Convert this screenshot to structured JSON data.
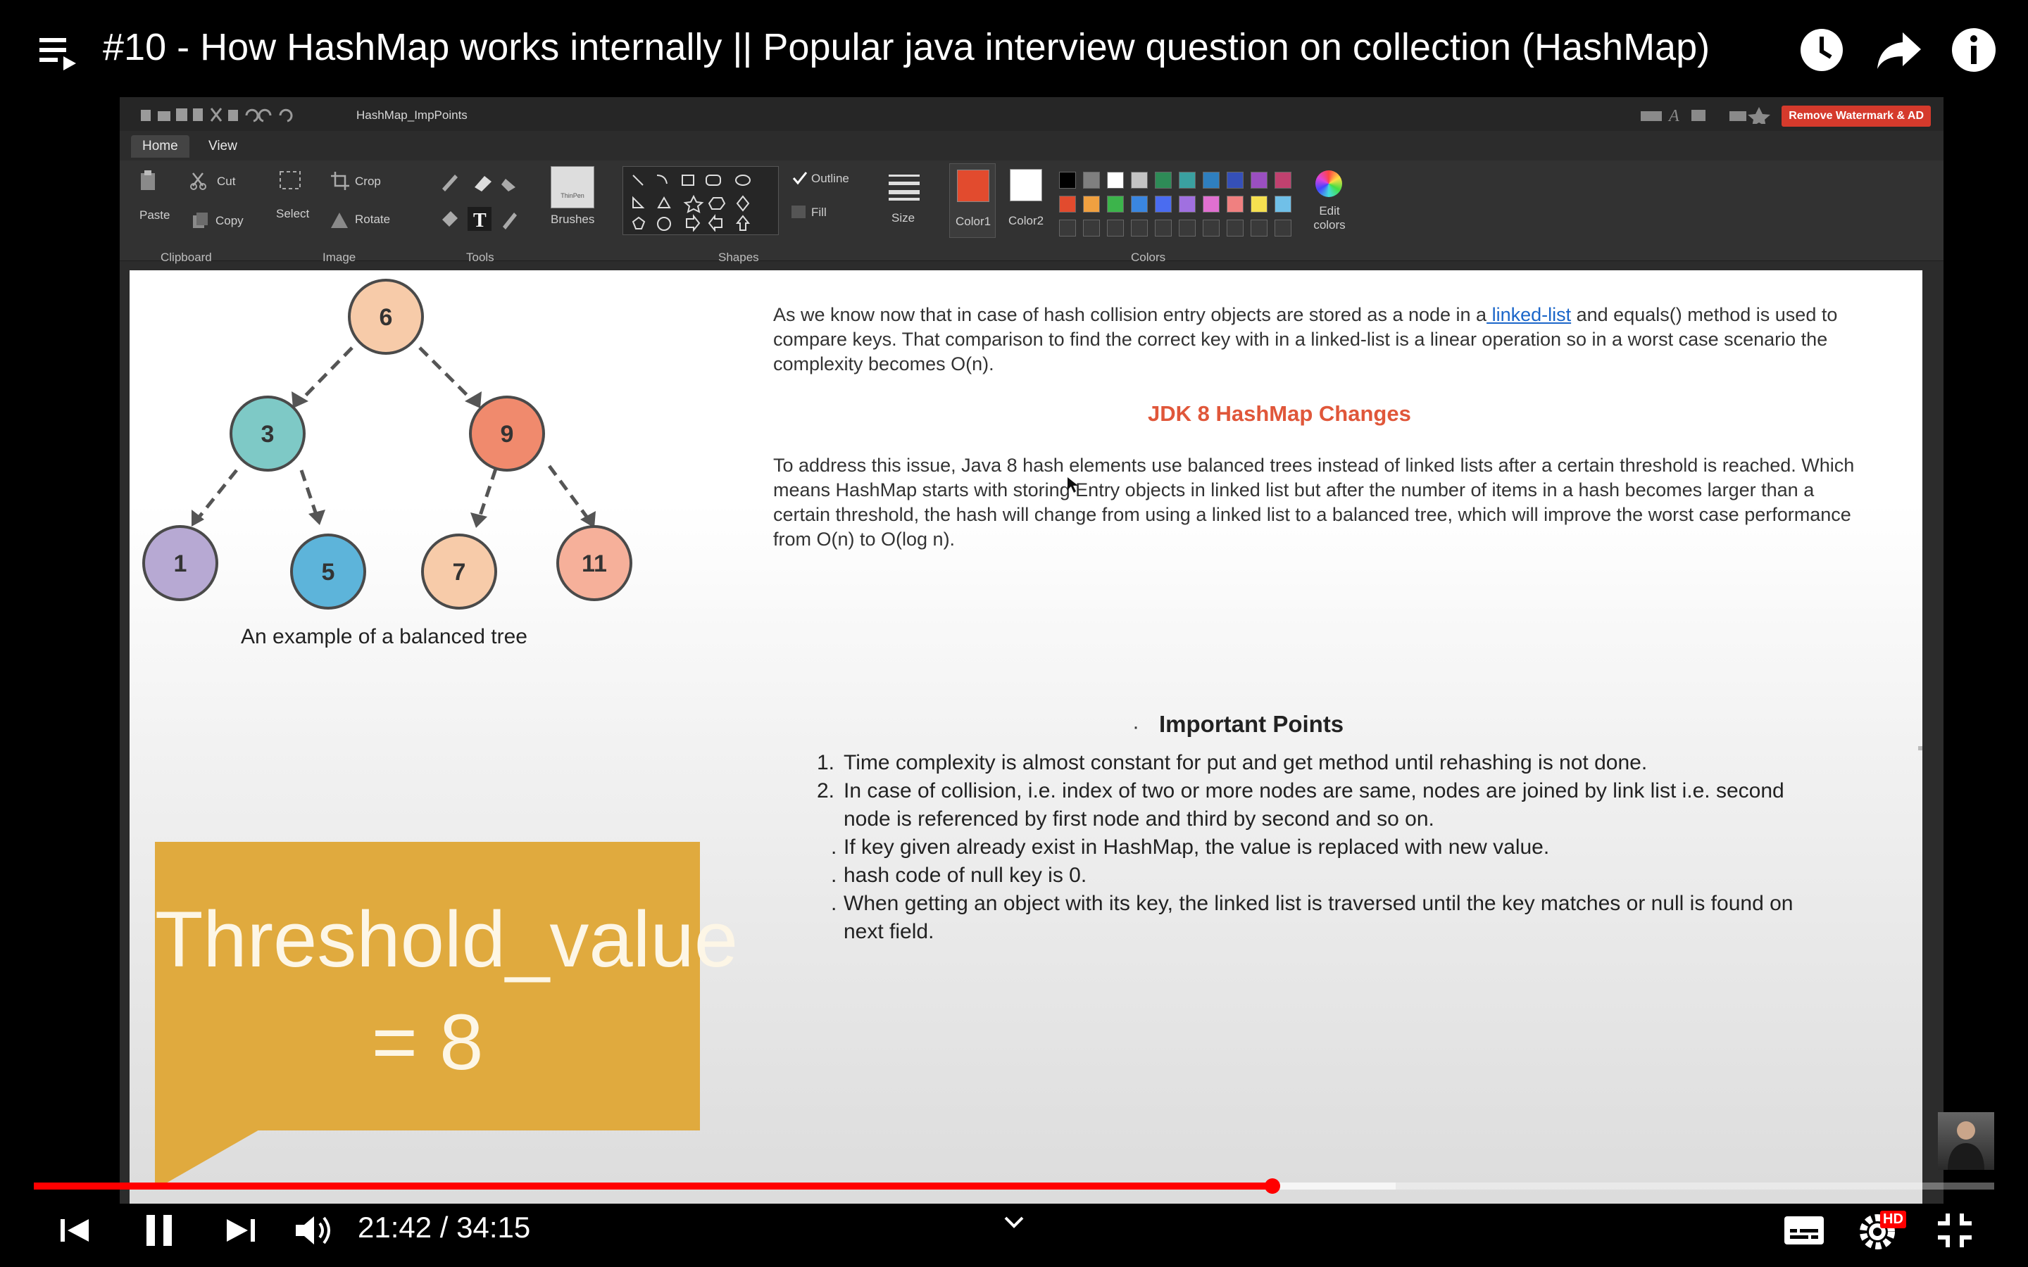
{
  "player": {
    "title": "#10 - How HashMap works internally || Popular java interview question on collection (HashMap)",
    "current_time": "21:42",
    "separator": "/",
    "duration": "34:15",
    "time_display": "21:42 / 34:15",
    "progress_fraction": 0.6355,
    "buffered_fraction": 0.6946,
    "hd_badge": "HD",
    "accent_color": "#ff0000",
    "top_icons": [
      "playlist-icon",
      "watch-later-icon",
      "share-icon",
      "info-icon"
    ],
    "control_icons": [
      "previous-icon",
      "pause-icon",
      "next-icon",
      "volume-icon",
      "chevron-down-icon",
      "captions-icon",
      "settings-icon",
      "exit-fullscreen-icon"
    ]
  },
  "paint": {
    "document_title": "HashMap_ImpPoints",
    "watermark_button": "Remove Watermark & AD",
    "tabs": [
      "Home",
      "View"
    ],
    "ribbon": {
      "clipboard": {
        "paste": "Paste",
        "cut": "Cut",
        "copy": "Copy",
        "group": "Clipboard"
      },
      "image": {
        "select": "Select",
        "crop": "Crop",
        "rotate": "Rotate",
        "group": "Image"
      },
      "tools": {
        "group": "Tools"
      },
      "brushes": {
        "label": "Brushes",
        "preview": "ThinPen"
      },
      "shapes": {
        "outline": "Outline",
        "fill": "Fill",
        "group": "Shapes"
      },
      "size": "Size",
      "color1": {
        "label": "Color1",
        "value": "#e24b2e"
      },
      "color2": {
        "label": "Color2",
        "value": "#ffffff"
      },
      "colors_group": "Colors",
      "edit_colors": "Edit colors",
      "palette_row1": [
        "#000000",
        "#7f7f7f",
        "#ffffff",
        "#c3c3c3",
        "#2e8b57",
        "#3aa0a0",
        "#2f7fbf",
        "#3550b8",
        "#9a4fc0",
        "#c0416f"
      ],
      "palette_row2": [
        "#e24b2e",
        "#f0a040",
        "#3cb44b",
        "#3a86e0",
        "#4a6cf0",
        "#a070e0",
        "#e070d0",
        "#f08080",
        "#f5e050",
        "#70c0e8"
      ]
    }
  },
  "slide": {
    "tree": {
      "caption": "An example of a balanced tree",
      "nodes": [
        {
          "label": "6",
          "color": "#f7cba9"
        },
        {
          "label": "3",
          "color": "#7ec9c6"
        },
        {
          "label": "9",
          "color": "#f08a6d"
        },
        {
          "label": "1",
          "color": "#b7a9d3"
        },
        {
          "label": "5",
          "color": "#5db4da"
        },
        {
          "label": "7",
          "color": "#f7cba9"
        },
        {
          "label": "11",
          "color": "#f6b09a"
        }
      ]
    },
    "intro": {
      "before_link": "As we know now that in case of hash collision entry objects are stored as a node in a",
      "link": " linked-list",
      "after_link": " and equals() method is used to compare keys. That comparison to find the correct key with in a linked-list is a linear operation so in a worst case scenario the complexity becomes O(n)."
    },
    "jdk_heading": "JDK 8 HashMap Changes",
    "jdk_paragraph": "To address this issue, Java 8 hash elements use balanced trees instead of linked lists after a certain threshold is reached. Which means HashMap starts with storing Entry objects in linked list but after the number of items in a hash becomes larger than a certain threshold, the hash will change from using a linked list to a balanced tree, which will improve the worst case performance from O(n) to O(log n).",
    "important_bullet": "·",
    "important_heading": "Important Points",
    "points": [
      {
        "num": "1.",
        "text": "Time complexity is almost constant for put and get method until rehashing is not done."
      },
      {
        "num": "2.",
        "text": "In case of collision, i.e. index of two or more nodes are same, nodes are joined by link list i.e. second node is referenced by first node and third by second and so on."
      },
      {
        "num": ".",
        "text": "If key given already exist in HashMap, the value is replaced with new value."
      },
      {
        "num": ".",
        "text": "hash code of null key is 0."
      },
      {
        "num": ".",
        "text": "When getting an object with its key, the linked list is traversed until the key matches or null is found on next field."
      }
    ],
    "threshold_line1": "Threshold_value",
    "threshold_line2": "= 8"
  }
}
